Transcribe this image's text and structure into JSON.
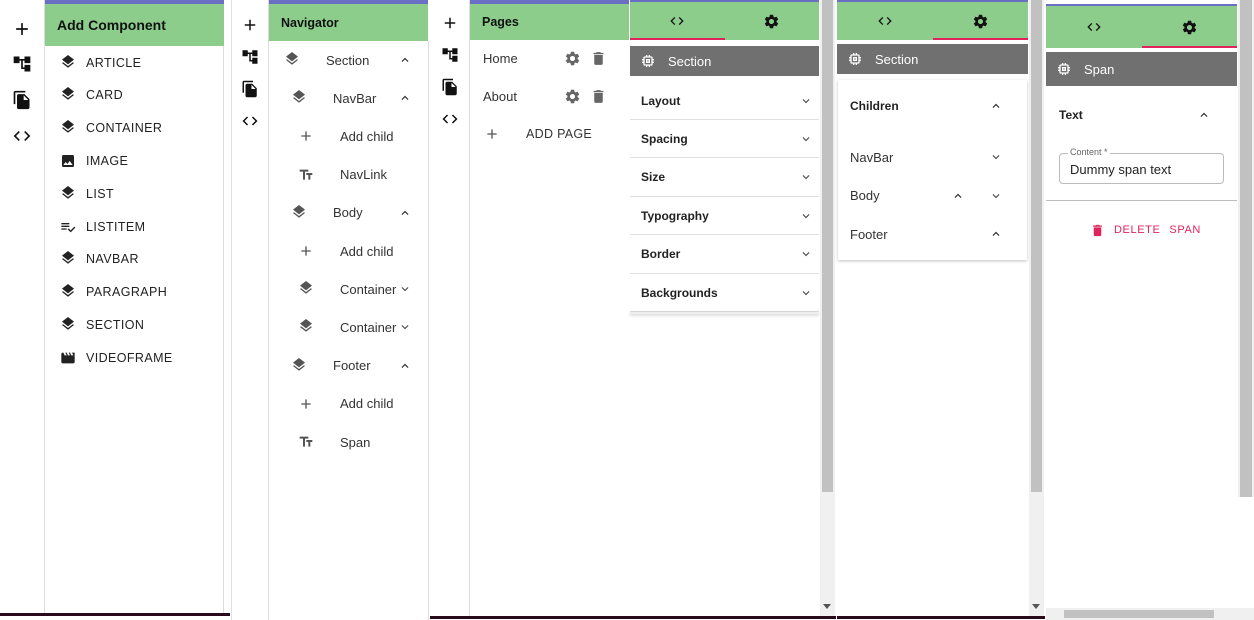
{
  "add_component": {
    "title": "Add Component",
    "items": [
      {
        "label": "ARTICLE",
        "icon": "layers-icon"
      },
      {
        "label": "CARD",
        "icon": "layers-icon"
      },
      {
        "label": "CONTAINER",
        "icon": "layers-icon"
      },
      {
        "label": "IMAGE",
        "icon": "image-icon"
      },
      {
        "label": "LIST",
        "icon": "layers-icon"
      },
      {
        "label": "LISTITEM",
        "icon": "playlist-check-icon"
      },
      {
        "label": "NAVBAR",
        "icon": "layers-icon"
      },
      {
        "label": "PARAGRAPH",
        "icon": "layers-icon"
      },
      {
        "label": "SECTION",
        "icon": "layers-icon"
      },
      {
        "label": "VIDEOFRAME",
        "icon": "movie-icon"
      }
    ]
  },
  "navigator": {
    "title": "Navigator",
    "rows": [
      {
        "label": "Section",
        "icon": "layers-icon",
        "chevron": "up"
      },
      {
        "label": "NavBar",
        "icon": "layers-icon",
        "chevron": "up"
      },
      {
        "label": "Add child",
        "icon": "plus-icon",
        "chevron": ""
      },
      {
        "label": "NavLink",
        "icon": "text-icon",
        "chevron": ""
      },
      {
        "label": "Body",
        "icon": "layers-icon",
        "chevron": "up"
      },
      {
        "label": "Add child",
        "icon": "plus-icon",
        "chevron": ""
      },
      {
        "label": "Container",
        "icon": "layers-icon",
        "chevron": "down"
      },
      {
        "label": "Container",
        "icon": "layers-icon",
        "chevron": "down"
      },
      {
        "label": "Footer",
        "icon": "layers-icon",
        "chevron": "up"
      },
      {
        "label": "Add child",
        "icon": "plus-icon",
        "chevron": ""
      },
      {
        "label": "Span",
        "icon": "text-icon",
        "chevron": ""
      }
    ]
  },
  "pages": {
    "title": "Pages",
    "items": [
      {
        "label": "Home"
      },
      {
        "label": "About"
      }
    ],
    "add_label": "ADD PAGE"
  },
  "settings_section": {
    "header_title": "Section",
    "groups": [
      "Layout",
      "Spacing",
      "Size",
      "Typography",
      "Border",
      "Backgrounds"
    ]
  },
  "children_panel": {
    "header_title": "Section",
    "heading": "Children",
    "children": [
      {
        "label": "NavBar"
      },
      {
        "label": "Body"
      },
      {
        "label": "Footer"
      }
    ]
  },
  "span_panel": {
    "header_title": "Span",
    "group_label": "Text",
    "content_label": "Content *",
    "content_value": "Dummy span text",
    "delete_label": "DELETE",
    "delete_target": "SPAN"
  },
  "colors": {
    "green_header": "#8ccd8c",
    "accent_pink": "#e0245e",
    "gray_bar": "#707070"
  }
}
